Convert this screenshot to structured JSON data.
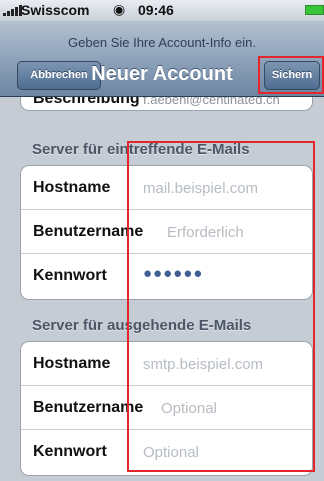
{
  "status_bar": {
    "carrier": "Swisscom",
    "wifi_icon": "wifi-icon",
    "time": "09:46",
    "battery_color": "#39c43a"
  },
  "navbar": {
    "prompt": "Geben Sie Ihre Account-Info ein.",
    "title": "Neuer Account",
    "cancel_label": "Abbrechen",
    "save_label": "Sichern"
  },
  "partial_row": {
    "label": "Beschreibung",
    "value": "f.aebehi@centinated.ch"
  },
  "incoming": {
    "header": "Server für eintreffende E-Mails",
    "hostname_label": "Hostname",
    "hostname_placeholder": "mail.beispiel.com",
    "username_label": "Benutzername",
    "username_placeholder": "Erforderlich",
    "password_label": "Kennwort",
    "password_value": "●●●●●●"
  },
  "outgoing": {
    "header": "Server für ausgehende E-Mails",
    "hostname_label": "Hostname",
    "hostname_placeholder": "smtp.beispiel.com",
    "username_label": "Benutzername",
    "username_placeholder": "Optional",
    "password_label": "Kennwort",
    "password_placeholder": "Optional"
  },
  "colors": {
    "highlight": "#e2262b",
    "nav_gradient_top": "#b4c1d0",
    "background": "#c5ccd4"
  }
}
